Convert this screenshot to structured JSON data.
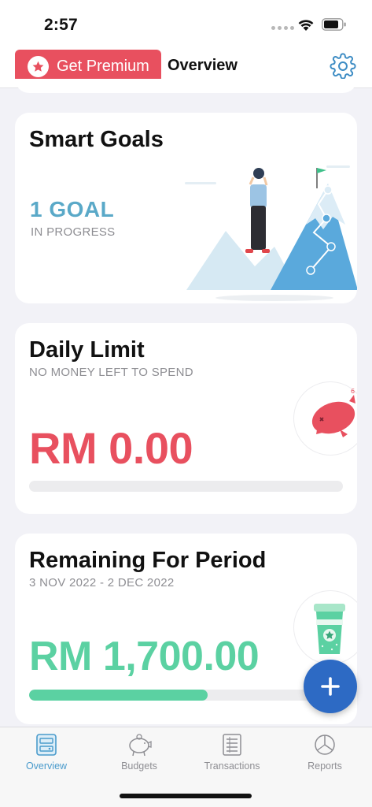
{
  "status_bar": {
    "time": "2:57"
  },
  "nav": {
    "premium_label": "Get Premium",
    "title": "Overview"
  },
  "smart_goals": {
    "title": "Smart Goals",
    "count": "1 GOAL",
    "status": "IN PROGRESS"
  },
  "daily_limit": {
    "title": "Daily Limit",
    "subtitle": "NO MONEY LEFT TO SPEND",
    "amount": "RM 0.00",
    "progress": 0
  },
  "remaining": {
    "title": "Remaining For Period",
    "period": "3 NOV 2022 - 2 DEC 2022",
    "amount": "RM 1,700.00",
    "progress": 0.57
  },
  "tabs": [
    {
      "label": "Overview",
      "icon": "overview-icon",
      "active": true
    },
    {
      "label": "Budgets",
      "icon": "piggy-bank-icon",
      "active": false
    },
    {
      "label": "Transactions",
      "icon": "transactions-icon",
      "active": false
    },
    {
      "label": "Reports",
      "icon": "pie-chart-icon",
      "active": false
    }
  ],
  "colors": {
    "accent": "#4a9bcc",
    "premium": "#e8505f",
    "fab": "#2d6ac4",
    "green": "#5bd1a2",
    "red": "#e8505f"
  }
}
